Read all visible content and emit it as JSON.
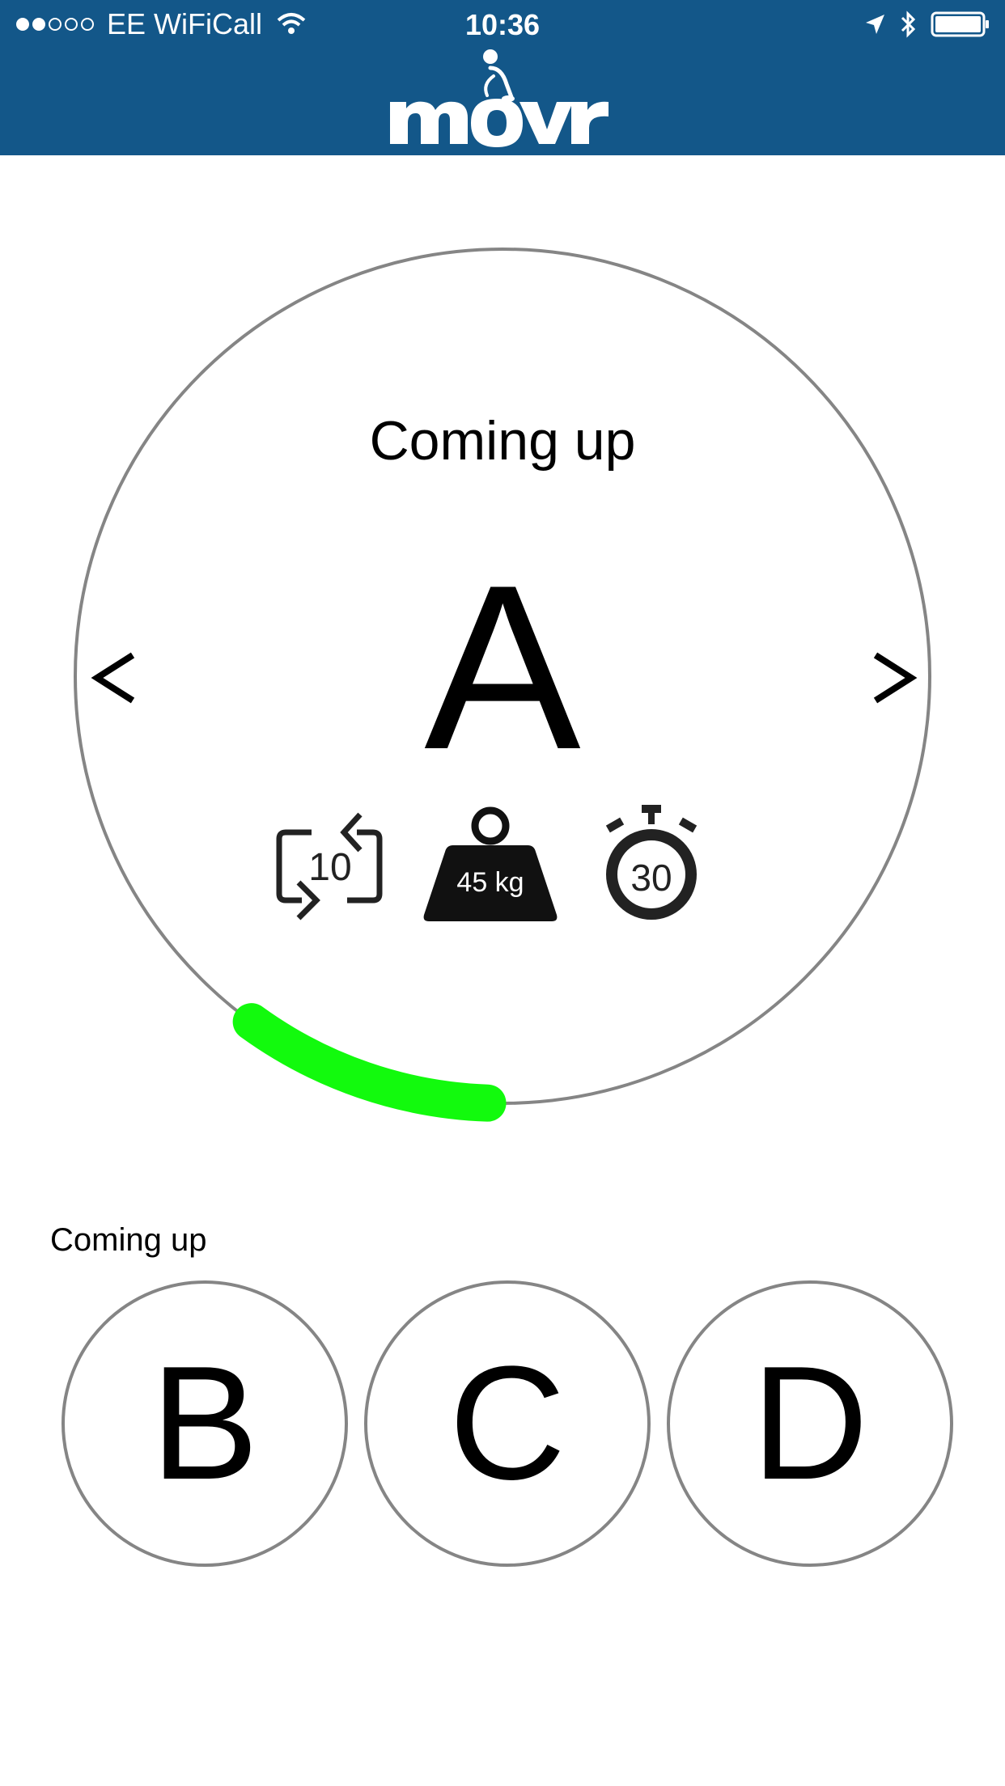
{
  "status_bar": {
    "carrier": "EE WiFiCall",
    "time": "10:36",
    "signal_dots_filled": 2,
    "signal_dots_total": 5
  },
  "header": {
    "brand": "movr",
    "background": "#135789"
  },
  "current": {
    "title": "Coming up",
    "letter": "A",
    "prev_label": "<",
    "next_label": ">",
    "reps": "10",
    "weight": "45 kg",
    "timer": "30",
    "progress_color": "#12fa0d"
  },
  "queue": {
    "label": "Coming up",
    "items": [
      "B",
      "C",
      "D"
    ]
  },
  "colors": {
    "ring": "#858585",
    "icon": "#222222"
  }
}
